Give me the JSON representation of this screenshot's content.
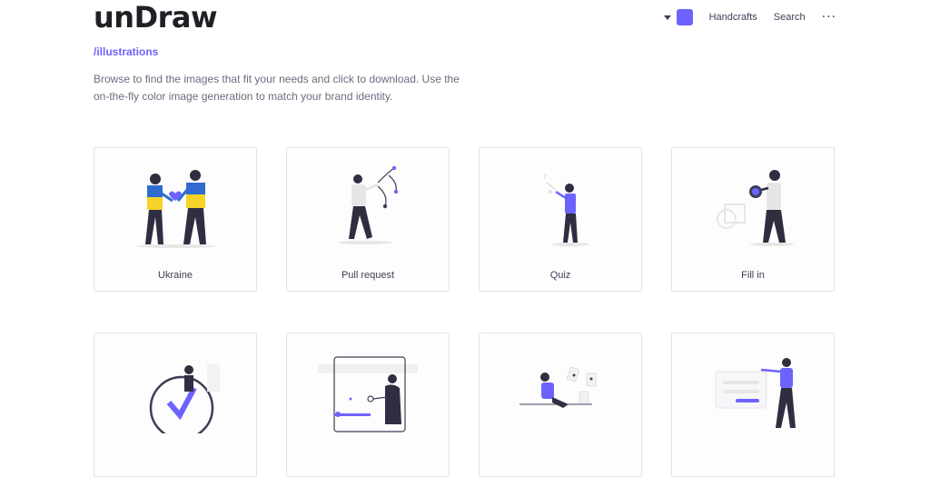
{
  "header": {
    "logo": "unDraw",
    "accent_color": "#6c63ff",
    "nav": {
      "handcrafts": "Handcrafts",
      "search": "Search",
      "more": "···"
    }
  },
  "intro": {
    "subtitle": "/illustrations",
    "description": "Browse to find the images that fit your needs and click to download. Use the on-the-fly color image generation to match your brand identity."
  },
  "cards": [
    {
      "label": "Ukraine"
    },
    {
      "label": "Pull request"
    },
    {
      "label": "Quiz"
    },
    {
      "label": "Fill in"
    },
    {
      "label": ""
    },
    {
      "label": ""
    },
    {
      "label": ""
    },
    {
      "label": ""
    }
  ]
}
